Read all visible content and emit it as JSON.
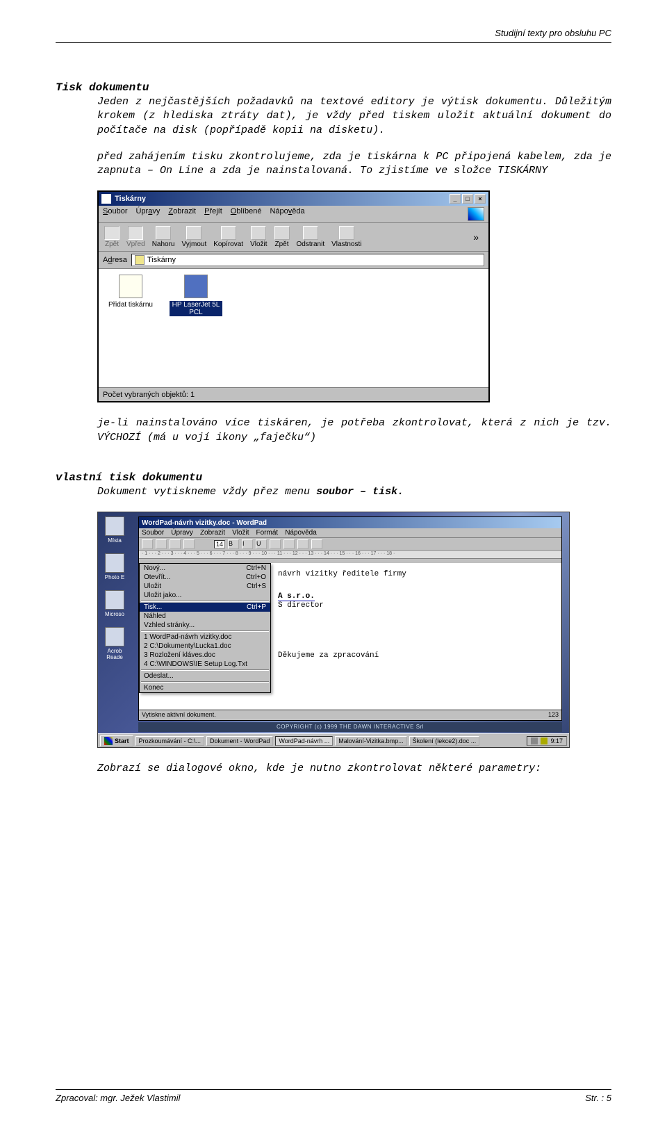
{
  "header": {
    "right": "Studijní texty pro obsluhu  PC"
  },
  "section1": {
    "title": "Tisk dokumentu",
    "p1": "Jeden z nejčastějších požadavků na textové editory je výtisk dokumentu. Důležitým krokem (z hlediska ztráty dat), je vždy před tiskem uložit aktuální dokument do počítače na disk (popřípadě kopii na disketu).",
    "p2": "před zahájením tisku zkontrolujeme, zda je tiskárna k PC připojená kabelem, zda je zapnuta – On Line a zda je nainstalovaná. To zjistíme ve složce TISKÁRNY"
  },
  "printers_window": {
    "title": "Tiskárny",
    "menu": {
      "soubor": "Soubor",
      "upravy": "Úpravy",
      "zobrazit": "Zobrazit",
      "prejit": "Přejít",
      "oblibene": "Oblíbené",
      "napoveda": "Nápověda"
    },
    "tools": {
      "zpet": "Zpět",
      "vpred": "Vpřed",
      "nahoru": "Nahoru",
      "vyjmout": "Vyjmout",
      "kopirovat": "Kopírovat",
      "vlozit": "Vložit",
      "zpet2": "Zpět",
      "odstranit": "Odstranit",
      "vlastnosti": "Vlastnosti"
    },
    "addr_label": "Adresa",
    "addr_value": "Tiskárny",
    "icons": {
      "add_printer": "Přidat tiskárnu",
      "hp": "HP LaserJet 5L PCL"
    },
    "status": "Počet vybraných objektů: 1"
  },
  "section2": {
    "p_after": "je-li nainstalováno více tiskáren, je potřeba zkontrolovat, která z nich je tzv. VÝCHOZÍ (má u vojí ikony „faječku“)"
  },
  "section3": {
    "title": "vlastní tisk dokumentu",
    "p1a": "Dokument vytiskneme vždy přez menu ",
    "p1b": "soubor – tisk.",
    "p2": "Zobrazí se dialogové okno, kde je nutno zkontrolovat některé parametry:"
  },
  "wordpad_shot": {
    "wp_title": "WordPad-návrh vizitky.doc - WordPad",
    "menu": {
      "soubor": "Soubor",
      "upravy": "Úpravy",
      "zobrazit": "Zobrazit",
      "vlozit": "Vložit",
      "format": "Formát",
      "napoveda": "Nápověda"
    },
    "font_size": "14",
    "ruler": "· 1 · · · 2 · · · 3 · · · 4 · · · 5 · · · 6 · · · 7 · · · 8 · · · 9 · · · 10 · · · 11 · · · 12 · · · 13 · · · 14 · · · 15 · · · 16 · · · 17 · · · 18 ·",
    "file_menu": {
      "novy": {
        "l": "Nový...",
        "r": "Ctrl+N"
      },
      "otevrit": {
        "l": "Otevřít...",
        "r": "Ctrl+O"
      },
      "ulozit": {
        "l": "Uložit",
        "r": "Ctrl+S"
      },
      "ulozit_jako": {
        "l": "Uložit jako...",
        "r": ""
      },
      "tisk": {
        "l": "Tisk...",
        "r": "Ctrl+P"
      },
      "nahled": {
        "l": "Náhled",
        "r": ""
      },
      "vzhled": {
        "l": "Vzhled stránky...",
        "r": ""
      },
      "r1": "1 WordPad-návrh vizitky.doc",
      "r2": "2 C:\\Dokumenty\\Lucka1.doc",
      "r3": "3 Rozložení kláves.doc",
      "r4": "4 C:\\WINDOWS\\IE Setup Log.Txt",
      "odeslat": "Odeslat...",
      "konec": "Konec"
    },
    "doc": {
      "l1": "návrh vizitky ředitele firmy",
      "l2": "A s.r.o.",
      "l3": "S director",
      "l4": "Děkujeme za zpracování"
    },
    "status_left": "Vytiskne aktivní dokument.",
    "status_right": "123",
    "copyright": "COPYRIGHT (c) 1999 THE DAWN INTERACTIVE Srl",
    "taskbar": {
      "start": "Start",
      "b1": "Prozkoumávání - C:\\...",
      "b2": "Dokument - WordPad",
      "b3": "WordPad-návrh ...",
      "b4": "Malování-Vizitka.bmp...",
      "b5": "Školení (lekce2).doc ...",
      "clock": "9:17"
    },
    "desk_icons": {
      "i1": "Místa",
      "i2": "Photo E",
      "i3": "Microso",
      "i4": "Acrob Reade"
    }
  },
  "footer": {
    "left": "Zpracoval: mgr. Ježek Vlastimil",
    "right": "Str. : 5"
  }
}
